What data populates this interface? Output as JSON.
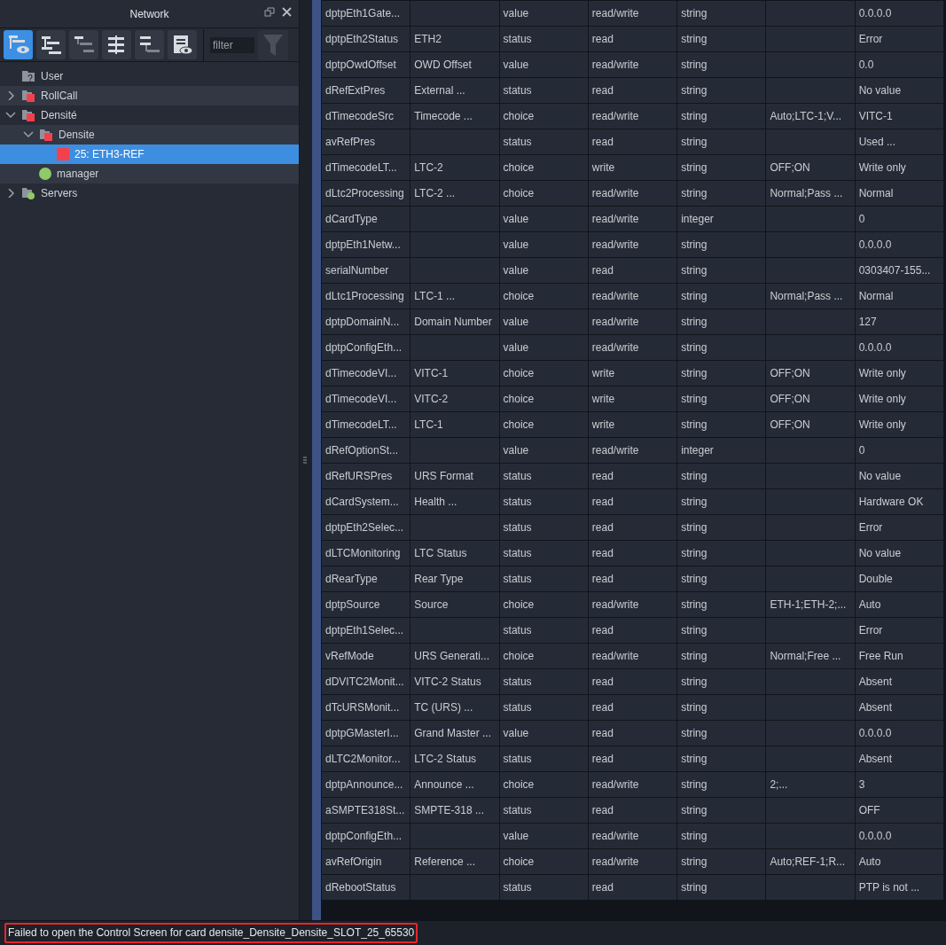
{
  "panel": {
    "title": "Network"
  },
  "toolbar": {
    "buttons": [
      {
        "kind": "tree-eye",
        "selected": true
      },
      {
        "kind": "tree-full",
        "selected": false
      },
      {
        "kind": "tree-dim",
        "selected": false
      },
      {
        "kind": "align",
        "selected": false
      },
      {
        "kind": "tree-step",
        "selected": false
      },
      {
        "kind": "list-eye",
        "selected": false
      }
    ],
    "filter": {
      "placeholder": "filter"
    }
  },
  "tree": [
    {
      "label": "User",
      "kind": "unknown",
      "selected": false
    },
    {
      "label": "RollCall",
      "kind": "folder",
      "color": "#f2414d",
      "expanded": false,
      "selected": false
    },
    {
      "label": "Densité",
      "kind": "folder",
      "color": "#f2414d",
      "expanded": true,
      "selected": false,
      "children": [
        {
          "label": "Densite",
          "kind": "folder",
          "color": "#f2414d",
          "expanded": true,
          "selected": false,
          "children": [
            {
              "label": "25: ETH3-REF",
              "kind": "device",
              "color": "#f2414d",
              "selected": true
            }
          ]
        },
        {
          "label": "manager",
          "kind": "service",
          "color": "#8ec96a",
          "selected": false
        }
      ]
    },
    {
      "label": "Servers",
      "kind": "folder-dot",
      "color": "#8ec96a",
      "expanded": false,
      "selected": false
    }
  ],
  "table": {
    "rows": [
      [
        "dptpEth1Gate...",
        null,
        "value",
        "read/write",
        "string",
        null,
        "0.0.0.0"
      ],
      [
        "dptpEth2Status",
        "ETH2",
        "status",
        "read",
        "string",
        null,
        "Error"
      ],
      [
        "dptpOwdOffset",
        "OWD Offset",
        "value",
        "read/write",
        "string",
        null,
        "0.0"
      ],
      [
        "dRefExtPres",
        "External ...",
        "status",
        "read",
        "string",
        null,
        "No value"
      ],
      [
        "dTimecodeSrc",
        "Timecode ...",
        "choice",
        "read/write",
        "string",
        "Auto;LTC-1;V...",
        "VITC-1"
      ],
      [
        "avRefPres",
        null,
        "status",
        "read",
        "string",
        null,
        "Used ..."
      ],
      [
        "dTimecodeLT...",
        "LTC-2",
        "choice",
        "write",
        "string",
        "OFF;ON",
        "Write only"
      ],
      [
        "dLtc2Processing",
        "LTC-2 ...",
        "choice",
        "read/write",
        "string",
        "Normal;Pass ...",
        "Normal"
      ],
      [
        "dCardType",
        null,
        "value",
        "read/write",
        "integer",
        null,
        "0"
      ],
      [
        "dptpEth1Netw...",
        null,
        "value",
        "read/write",
        "string",
        null,
        "0.0.0.0"
      ],
      [
        "serialNumber",
        null,
        "value",
        "read",
        "string",
        null,
        "0303407-155..."
      ],
      [
        "dLtc1Processing",
        "LTC-1 ...",
        "choice",
        "read/write",
        "string",
        "Normal;Pass ...",
        "Normal"
      ],
      [
        "dptpDomainN...",
        "Domain Number",
        "value",
        "read/write",
        "string",
        null,
        "127"
      ],
      [
        "dptpConfigEth...",
        null,
        "value",
        "read/write",
        "string",
        null,
        "0.0.0.0"
      ],
      [
        "dTimecodeVI...",
        "VITC-1",
        "choice",
        "write",
        "string",
        "OFF;ON",
        "Write only"
      ],
      [
        "dTimecodeVI...",
        "VITC-2",
        "choice",
        "write",
        "string",
        "OFF;ON",
        "Write only"
      ],
      [
        "dTimecodeLT...",
        "LTC-1",
        "choice",
        "write",
        "string",
        "OFF;ON",
        "Write only"
      ],
      [
        "dRefOptionSt...",
        null,
        "value",
        "read/write",
        "integer",
        null,
        "0"
      ],
      [
        "dRefURSPres",
        "URS Format",
        "status",
        "read",
        "string",
        null,
        "No value"
      ],
      [
        "dCardSystem...",
        "Health ...",
        "status",
        "read",
        "string",
        null,
        "Hardware OK"
      ],
      [
        "dptpEth2Selec...",
        null,
        "status",
        "read",
        "string",
        null,
        "Error"
      ],
      [
        "dLTCMonitoring",
        "LTC Status",
        "status",
        "read",
        "string",
        null,
        "No value"
      ],
      [
        "dRearType",
        "Rear Type",
        "status",
        "read",
        "string",
        null,
        "Double"
      ],
      [
        "dptpSource",
        "Source",
        "choice",
        "read/write",
        "string",
        "ETH-1;ETH-2;...",
        "Auto"
      ],
      [
        "dptpEth1Selec...",
        null,
        "status",
        "read",
        "string",
        null,
        "Error"
      ],
      [
        "vRefMode",
        "URS Generati...",
        "choice",
        "read/write",
        "string",
        "Normal;Free ...",
        "Free Run"
      ],
      [
        "dDVITC2Monit...",
        "VITC-2 Status",
        "status",
        "read",
        "string",
        null,
        "Absent"
      ],
      [
        "dTcURSMonit...",
        "TC (URS) ...",
        "status",
        "read",
        "string",
        null,
        "Absent"
      ],
      [
        "dptpGMasterI...",
        "Grand Master ...",
        "value",
        "read",
        "string",
        null,
        "0.0.0.0"
      ],
      [
        "dLTC2Monitor...",
        "LTC-2 Status",
        "status",
        "read",
        "string",
        null,
        "Absent"
      ],
      [
        "dptpAnnounce...",
        "Announce ...",
        "choice",
        "read/write",
        "string",
        "2;...",
        "3"
      ],
      [
        "aSMPTE318St...",
        "SMPTE-318 ...",
        "status",
        "read",
        "string",
        null,
        "OFF"
      ],
      [
        "dptpConfigEth...",
        null,
        "value",
        "read/write",
        "string",
        null,
        "0.0.0.0"
      ],
      [
        "avRefOrigin",
        "Reference ...",
        "choice",
        "read/write",
        "string",
        "Auto;REF-1;R...",
        "Auto"
      ],
      [
        "dRebootStatus",
        null,
        "status",
        "read",
        "string",
        null,
        "PTP is not ..."
      ]
    ]
  },
  "status_bar": {
    "message": "Failed to open the Control Screen for card densite_Densite_Densite_SLOT_25_65530"
  }
}
